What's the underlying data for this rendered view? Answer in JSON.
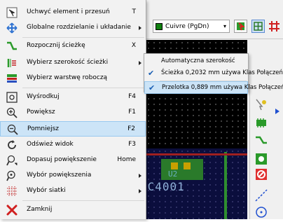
{
  "toolbar": {
    "layer_value": "Cuivre (PgDn)",
    "layer_color": "#108010"
  },
  "canvas": {
    "ref_text": "4C4001",
    "value_text": "U2"
  },
  "menu": {
    "items": [
      {
        "label": "Uchwyć element i przesuń",
        "shortcut": "T",
        "icon": "grab-move-icon"
      },
      {
        "label": "Globalne rozdzielanie i układanie",
        "shortcut": "",
        "icon": "spread-place-icon",
        "submenu": true
      },
      {
        "label": "Rozpocznij ścieżkę",
        "shortcut": "X",
        "icon": "route-track-icon"
      },
      {
        "label": "Wybierz szerokość ścieżki",
        "shortcut": "",
        "icon": "track-width-icon",
        "submenu": true
      },
      {
        "label": "Wybierz warstwę roboczą",
        "shortcut": "",
        "icon": "select-layer-icon"
      },
      {
        "label": "Wyśrodkuj",
        "shortcut": "F4",
        "icon": "zoom-center-icon"
      },
      {
        "label": "Powiększ",
        "shortcut": "F1",
        "icon": "zoom-in-icon"
      },
      {
        "label": "Pomniejsz",
        "shortcut": "F2",
        "icon": "zoom-out-icon"
      },
      {
        "label": "Odśwież widok",
        "shortcut": "F3",
        "icon": "refresh-icon"
      },
      {
        "label": "Dopasuj powiększenie",
        "shortcut": "Home",
        "icon": "zoom-fit-icon"
      },
      {
        "label": "Wybór powiększenia",
        "shortcut": "",
        "icon": "zoom-select-icon",
        "submenu": true
      },
      {
        "label": "Wybór siatki",
        "shortcut": "",
        "icon": "grid-select-icon",
        "submenu": true
      },
      {
        "label": "Zamknij",
        "shortcut": "",
        "icon": "close-icon"
      }
    ]
  },
  "submenu": {
    "items": [
      {
        "label": "Automatyczna szerokość",
        "checked": false
      },
      {
        "label": "Ścieżka 0,2032 mm używa Klas Połączeń",
        "checked": true
      },
      {
        "label": "Przelotka 0,889 mm używa Klas Połączeń",
        "checked": true
      }
    ]
  }
}
